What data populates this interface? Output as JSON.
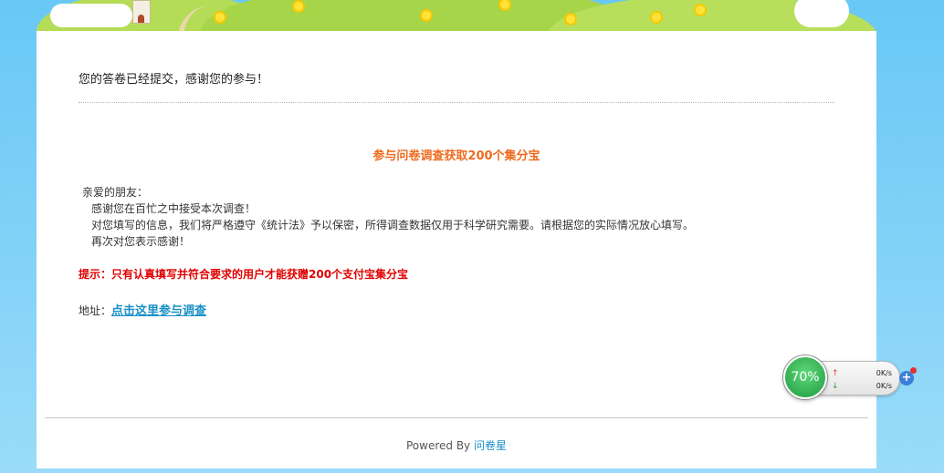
{
  "confirmation": {
    "message": "您的答卷已经提交，感谢您的参与！"
  },
  "survey": {
    "title": "参与问卷调查获取200个集分宝",
    "letter": {
      "greeting": "亲爱的朋友：",
      "line1": "感谢您在百忙之中接受本次调查！",
      "line2": "对您填写的信息，我们将严格遵守《统计法》予以保密，所得调查数据仅用于科学研究需要。请根据您的实际情况放心填写。",
      "line3": "再次对您表示感谢！"
    },
    "tip": "提示：只有认真填写并符合要求的用户才能获赠200个支付宝集分宝",
    "address_label": "地址：",
    "address_link": "点击这里参与调查"
  },
  "footer": {
    "powered_by": "Powered By",
    "brand": "问卷星"
  },
  "speed_widget": {
    "percent": "70%",
    "upload": "0K/s",
    "download": "0K/s",
    "icons": {
      "upload": "arrow-up-icon",
      "download": "arrow-down-icon",
      "expand": "plus-icon"
    },
    "colors": {
      "circle": "#2fb352",
      "upload_arrow": "#e03a2a",
      "download_arrow": "#2aa043",
      "plus": "#3b7fd8"
    }
  },
  "colors": {
    "title_orange": "#ee6a1e",
    "tip_red": "#e00000",
    "link_blue": "#1a8fc8",
    "sky": "#69c8f5"
  }
}
